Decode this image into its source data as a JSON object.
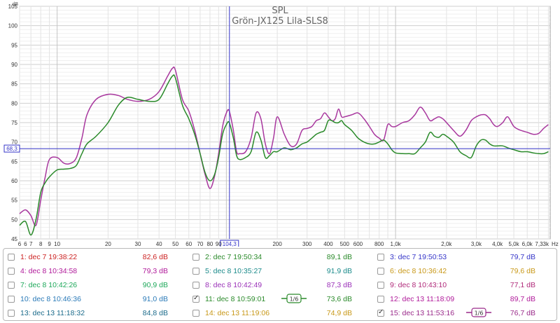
{
  "chart_data": {
    "type": "line",
    "title": "SPL",
    "subtitle": "Grön-JX125 Lila-SLS8",
    "y_unit": "dB",
    "x_unit": "Hz",
    "x_scale": "log",
    "xlim": [
      6,
      8200
    ],
    "ylim": [
      45,
      105
    ],
    "grid": true,
    "y_ticks": [
      45,
      50,
      55,
      60,
      65,
      70,
      75,
      80,
      85,
      90,
      95,
      100,
      105
    ],
    "x_ticks": [
      {
        "v": 6,
        "label": "6"
      },
      {
        "v": 6.5,
        "label": "6"
      },
      {
        "v": 7,
        "label": "7"
      },
      {
        "v": 8,
        "label": "8"
      },
      {
        "v": 9,
        "label": "9"
      },
      {
        "v": 10,
        "label": "10"
      },
      {
        "v": 20,
        "label": "20"
      },
      {
        "v": 30,
        "label": "30"
      },
      {
        "v": 40,
        "label": "40"
      },
      {
        "v": 50,
        "label": "50"
      },
      {
        "v": 60,
        "label": "60"
      },
      {
        "v": 70,
        "label": "70"
      },
      {
        "v": 80,
        "label": "80"
      },
      {
        "v": 90,
        "label": "90"
      },
      {
        "v": 200,
        "label": "200"
      },
      {
        "v": 300,
        "label": "300"
      },
      {
        "v": 400,
        "label": "400"
      },
      {
        "v": 500,
        "label": "500"
      },
      {
        "v": 600,
        "label": "600"
      },
      {
        "v": 800,
        "label": "800"
      },
      {
        "v": 1000,
        "label": "1,0k"
      },
      {
        "v": 2000,
        "label": "2,0k"
      },
      {
        "v": 3000,
        "label": "3,0k"
      },
      {
        "v": 4000,
        "label": "4,0k"
      },
      {
        "v": 5000,
        "label": "5,0k"
      },
      {
        "v": 6000,
        "label": "6,0k"
      },
      {
        "v": 7330,
        "label": "7,33k"
      }
    ],
    "cursor": {
      "x": 104.3,
      "x_label": "104,3",
      "y": 68.3,
      "y_label": "68,3"
    },
    "series": [
      {
        "name": "Lila-SLS8",
        "color": "#a8379e",
        "x": [
          6,
          6.5,
          7,
          7.5,
          8,
          8.5,
          9,
          10,
          11,
          12,
          13,
          14,
          15,
          17,
          20,
          23,
          26,
          30,
          35,
          40,
          45,
          48,
          50,
          55,
          60,
          65,
          70,
          75,
          80,
          85,
          90,
          95,
          100,
          104,
          110,
          115,
          120,
          130,
          140,
          150,
          160,
          170,
          180,
          190,
          200,
          220,
          240,
          260,
          280,
          300,
          320,
          340,
          360,
          380,
          400,
          420,
          440,
          460,
          480,
          500,
          550,
          600,
          650,
          700,
          750,
          800,
          850,
          900,
          950,
          1000,
          1100,
          1200,
          1300,
          1400,
          1500,
          1600,
          1700,
          1800,
          1900,
          2000,
          2200,
          2400,
          2600,
          2800,
          3000,
          3200,
          3400,
          3600,
          3800,
          4000,
          4300,
          4600,
          5000,
          5500,
          6000,
          6500,
          7000,
          7500,
          8000
        ],
        "values": [
          51.5,
          52.5,
          51,
          48.5,
          55,
          61,
          65.5,
          66,
          64.5,
          64.5,
          66,
          71,
          77,
          81,
          82.3,
          82,
          81,
          80.5,
          81,
          83,
          87,
          89,
          88.5,
          81,
          78,
          73,
          67,
          61.5,
          58,
          61,
          67,
          74,
          77.5,
          78,
          73,
          67.5,
          67,
          67.5,
          71,
          77.5,
          76,
          69.5,
          67,
          71,
          76.5,
          72,
          69,
          69.5,
          73,
          73.5,
          74,
          75.5,
          76,
          77.5,
          76.5,
          75.5,
          76,
          78.5,
          76.5,
          76.5,
          77,
          77.5,
          76,
          74,
          72,
          71,
          70.5,
          74.5,
          74,
          74,
          75,
          75.5,
          77,
          79,
          77.5,
          75.5,
          76,
          76.5,
          76,
          75,
          73,
          71.5,
          73,
          75.5,
          76.5,
          77,
          77,
          76,
          74.5,
          74,
          75,
          76.5,
          74,
          73,
          72.5,
          72,
          72.2,
          73.5,
          74.5
        ]
      },
      {
        "name": "Grön-JX125",
        "color": "#2a8a2a",
        "x": [
          6,
          6.5,
          7,
          7.5,
          8,
          8.5,
          9,
          10,
          11,
          12,
          13,
          14,
          15,
          17,
          20,
          23,
          26,
          30,
          35,
          40,
          45,
          48,
          50,
          55,
          60,
          65,
          70,
          75,
          80,
          85,
          90,
          95,
          100,
          104,
          110,
          115,
          120,
          130,
          140,
          150,
          160,
          170,
          180,
          190,
          200,
          220,
          240,
          260,
          280,
          300,
          320,
          340,
          360,
          380,
          400,
          420,
          440,
          460,
          480,
          500,
          550,
          600,
          650,
          700,
          750,
          800,
          850,
          900,
          950,
          1000,
          1100,
          1200,
          1300,
          1400,
          1500,
          1600,
          1700,
          1800,
          1900,
          2000,
          2200,
          2400,
          2600,
          2800,
          3000,
          3200,
          3400,
          3600,
          3800,
          4000,
          4300,
          4600,
          5000,
          5500,
          6000,
          6500,
          7000,
          7500,
          8000
        ],
        "values": [
          48.5,
          49.5,
          46,
          50,
          57,
          59.5,
          61,
          62.8,
          63,
          63.2,
          64,
          67,
          69.5,
          71.5,
          75,
          79.5,
          81.5,
          81,
          80.5,
          81,
          85,
          87,
          86.5,
          79.5,
          76,
          72,
          67,
          62,
          60,
          61.5,
          66,
          72,
          74.5,
          75,
          71,
          66.5,
          65.5,
          66,
          67.5,
          72.5,
          70.5,
          66,
          66.5,
          67.5,
          67.5,
          68.5,
          68,
          68.5,
          69.5,
          70,
          71,
          72,
          72.5,
          73,
          75.5,
          75.5,
          75,
          75,
          75.5,
          74.5,
          73,
          71,
          70,
          69.5,
          69.5,
          70,
          70.5,
          69.5,
          68,
          67.2,
          67,
          67,
          67,
          68.5,
          70,
          72.5,
          71.5,
          71.2,
          72,
          71.5,
          70,
          67.5,
          66.5,
          66,
          69,
          70.5,
          70.5,
          69.5,
          69,
          69,
          69,
          68.5,
          68,
          67.5,
          67.5,
          67.2,
          67,
          67,
          67.5
        ]
      }
    ]
  },
  "legend": [
    {
      "label": "1: dec 7 19:38:22",
      "value": "82,6 dB",
      "color": "#cc2222",
      "checked": false
    },
    {
      "label": "2: dec 7 19:50:34",
      "value": "89,1 dB",
      "color": "#2a8a2a",
      "checked": false
    },
    {
      "label": "3: dec 7 19:50:53",
      "value": "79,7 dB",
      "color": "#3535c8",
      "checked": false
    },
    {
      "label": "4: dec 8 10:34:58",
      "value": "79,3 dB",
      "color": "#b01a9a",
      "checked": false
    },
    {
      "label": "5: dec 8 10:35:27",
      "value": "91,9 dB",
      "color": "#1a8a8a",
      "checked": false
    },
    {
      "label": "6: dec 8 10:36:42",
      "value": "79,6 dB",
      "color": "#c89818",
      "checked": false
    },
    {
      "label": "7: dec 8 10:42:26",
      "value": "90,9 dB",
      "color": "#1ea85a",
      "checked": false
    },
    {
      "label": "8: dec 8 10:42:49",
      "value": "87,3 dB",
      "color": "#9a30b8",
      "checked": false
    },
    {
      "label": "9: dec 8 10:43:10",
      "value": "77,1 dB",
      "color": "#b02a7a",
      "checked": false
    },
    {
      "label": "10: dec 8 10:46:36",
      "value": "91,0 dB",
      "color": "#2a7ab8",
      "checked": false
    },
    {
      "label": "11: dec 8 10:59:01",
      "value": "73,6 dB",
      "color": "#2a8a2a",
      "checked": true,
      "smoothing": "1/6"
    },
    {
      "label": "12: dec 13 11:18:09",
      "value": "89,7 dB",
      "color": "#b01a9a",
      "checked": false
    },
    {
      "label": "13: dec 13 11:18:32",
      "value": "84,8 dB",
      "color": "#1a6a8a",
      "checked": false
    },
    {
      "label": "14: dec 13 11:19:06",
      "value": "74,9 dB",
      "color": "#c89818",
      "checked": false
    },
    {
      "label": "15: dec 13 11:53:16",
      "value": "76,7 dB",
      "color": "#9a2a8a",
      "checked": true,
      "smoothing": "1/6"
    }
  ]
}
